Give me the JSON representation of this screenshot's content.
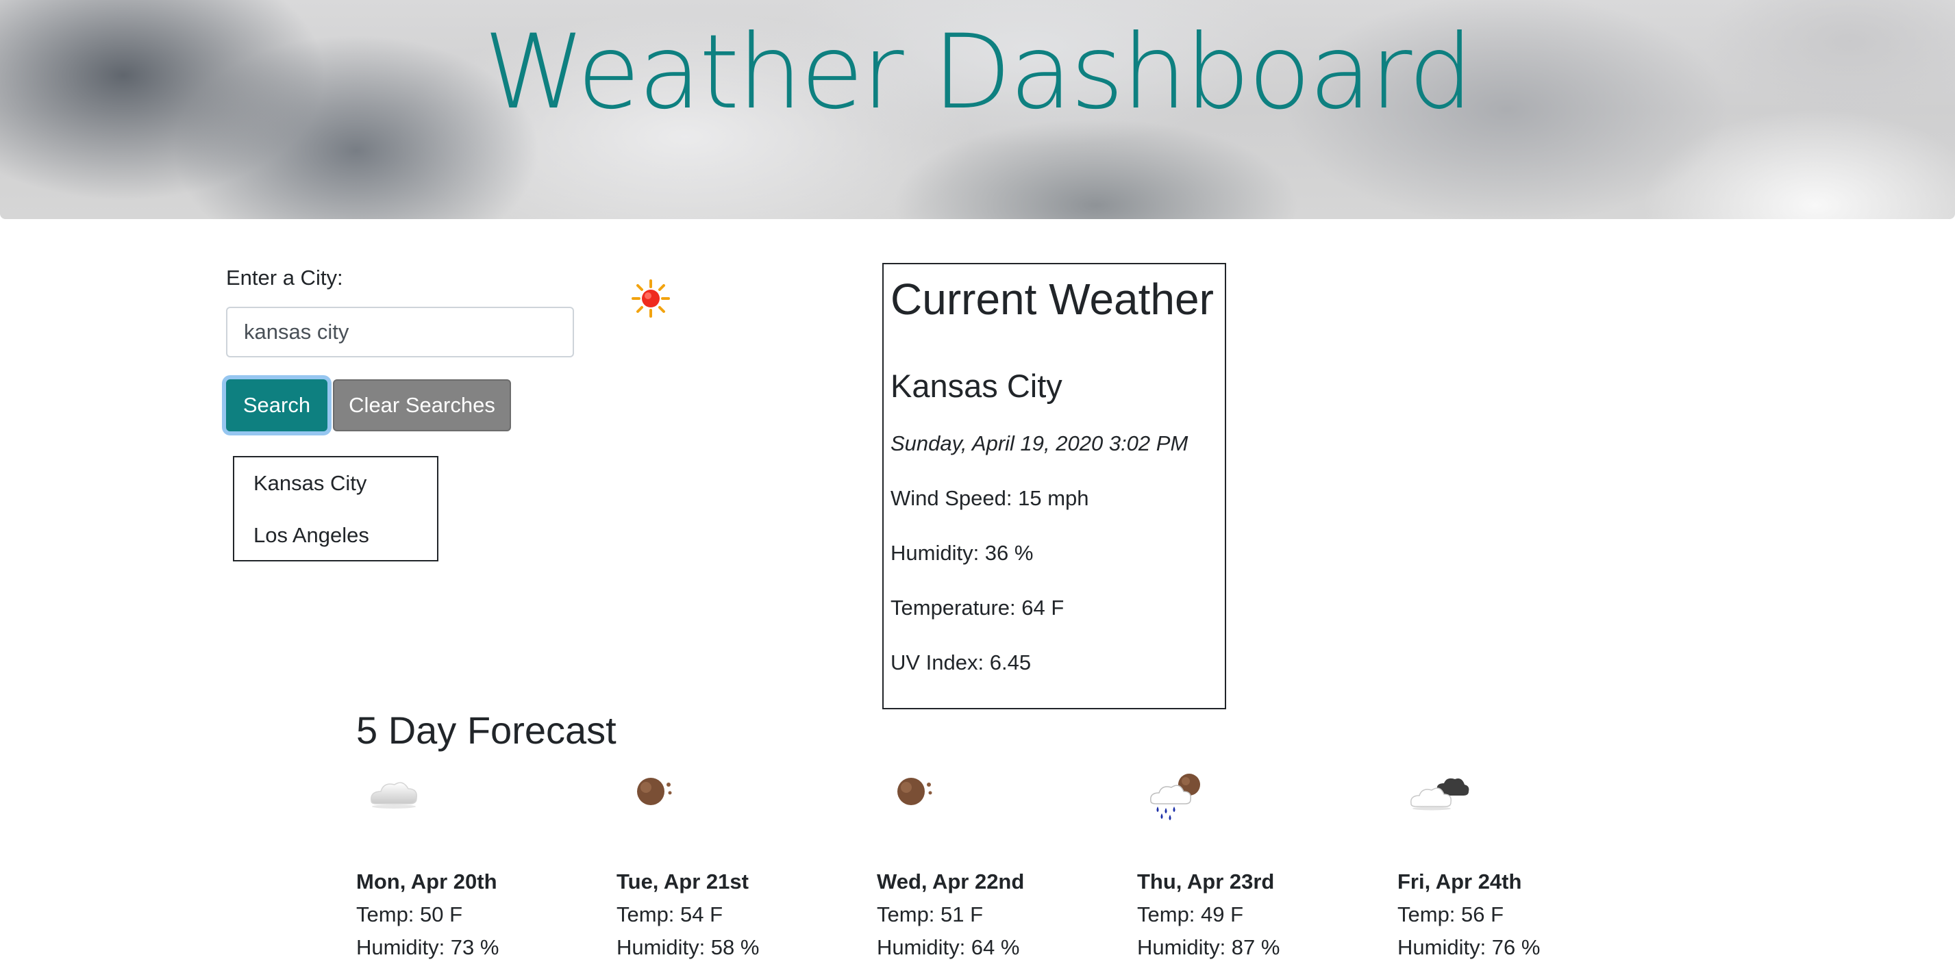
{
  "header": {
    "title": "Weather Dashboard"
  },
  "search": {
    "label": "Enter a City:",
    "value": "kansas city",
    "search_button": "Search",
    "clear_button": "Clear Searches"
  },
  "history": [
    "Kansas City",
    "Los Angeles"
  ],
  "current": {
    "icon": "sun-icon",
    "heading": "Current Weather",
    "city": "Kansas City",
    "datetime": "Sunday, April 19, 2020 3:02 PM",
    "wind": "Wind Speed: 15 mph",
    "humidity": "Humidity: 36 %",
    "temperature": "Temperature: 64 F",
    "uv": "UV Index: 6.45"
  },
  "forecast": {
    "title": "5 Day Forecast",
    "days": [
      {
        "icon": "cloud-icon",
        "date": "Mon, Apr 20th",
        "temp": "Temp: 50 F",
        "humidity": "Humidity: 73 %"
      },
      {
        "icon": "moon-icon",
        "date": "Tue, Apr 21st",
        "temp": "Temp: 54 F",
        "humidity": "Humidity: 58 %"
      },
      {
        "icon": "moon-icon",
        "date": "Wed, Apr 22nd",
        "temp": "Temp: 51 F",
        "humidity": "Humidity: 64 %"
      },
      {
        "icon": "rain-cloud-moon-icon",
        "date": "Thu, Apr 23rd",
        "temp": "Temp: 49 F",
        "humidity": "Humidity: 87 %"
      },
      {
        "icon": "cloud-moon-icon",
        "date": "Fri, Apr 24th",
        "temp": "Temp: 56 F",
        "humidity": "Humidity: 76 %"
      }
    ]
  },
  "colors": {
    "accent": "#0e8080",
    "clear_button": "#838383",
    "text": "#212529"
  }
}
